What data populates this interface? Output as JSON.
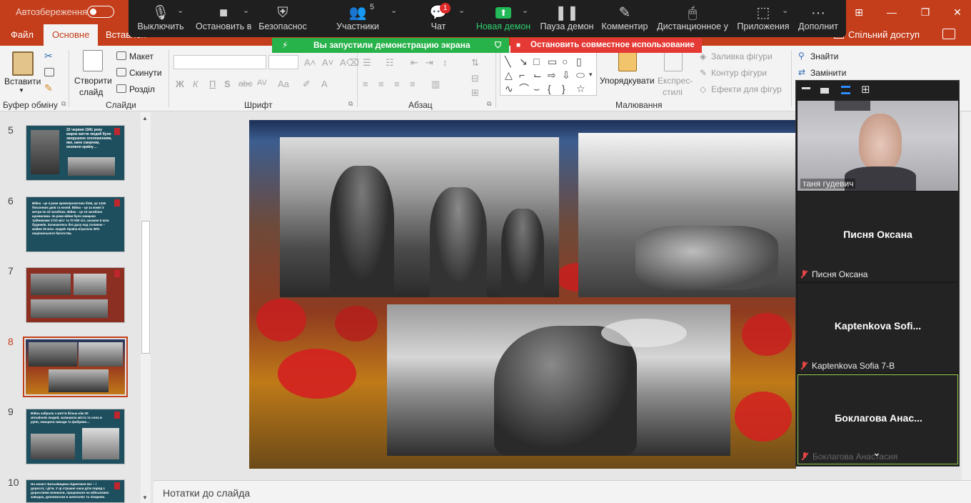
{
  "titlebar": {
    "autosave_label": "Автозбереження",
    "window_controls": [
      "⊞",
      "—",
      "❐",
      "✕"
    ]
  },
  "ribbon_tabs": {
    "file": "Файл",
    "home": "Основне",
    "insert": "Вставлен",
    "share": "Спільний доступ"
  },
  "ribbon": {
    "clipboard": {
      "paste": "Вставити",
      "label": "Буфер обміну"
    },
    "slides": {
      "new_slide_line1": "Створити",
      "new_slide_line2": "слайд",
      "layout": "Макет",
      "reset": "Скинути",
      "section": "Розділ",
      "label": "Слайди"
    },
    "font": {
      "label": "Шрифт",
      "bold": "Ж",
      "italic": "К",
      "underline": "П",
      "strike": "abc",
      "spacing": "AV",
      "case": "Aa"
    },
    "paragraph": {
      "label": "Абзац"
    },
    "drawing": {
      "arrange": "Упорядкувати",
      "quick_styles_line1": "Експрес-",
      "quick_styles_line2": "стилі",
      "shape_fill": "Заливка фігури",
      "shape_outline": "Контур фігури",
      "shape_effects": "Ефекти для фігур",
      "label": "Малювання"
    },
    "editing": {
      "find": "Знайти",
      "replace": "Замінити"
    }
  },
  "zoom_toolbar": {
    "mute": "Выключить",
    "stop_video": "Остановить в",
    "security": "Безопаснос",
    "participants": "Участники",
    "participants_count": "5",
    "chat": "Чат",
    "chat_badge": "1",
    "new_share": "Новая демон",
    "pause_share": "Пауза демон",
    "annotate": "Комментир",
    "remote_control": "Дистанционное у",
    "apps": "Приложения",
    "more": "Дополнит"
  },
  "share_banner": {
    "sharing_text": "Вы запустили демонстрацию экрана",
    "stop_text": "Остановить совместное использование"
  },
  "thumbnails": [
    {
      "num": "5",
      "text": "22 червня 1941 року мирне життя людей було зворушене оголошенням, яке, наче смерчем, охопило країну…"
    },
    {
      "num": "6",
      "text": "Війна - це 4 роки кровопролитних боїв, це 1418 безсонних днів та ночей. Війна – це за кожні 3 метри по 22 загиблих. Війна – це 13 загиблих щохвилини. За роки війни було знищено трійниками 1710 міст та 70 000 сіл, сказано 6 млн. будинків. Залишились без даху над головою – майже 25 млн. людей. Країна втратила 30% національного багатства."
    },
    {
      "num": "7",
      "text": ""
    },
    {
      "num": "8",
      "text": ""
    },
    {
      "num": "9",
      "text": "Війна забрала з життя більш ніж 20 мільйонів людей, залишила міста та села в руїні, знищила заводи та фабрики…"
    },
    {
      "num": "10",
      "text": "На захист Батьківщини піднялися всі – і дорослі, і діти. У ці страшні часи діти поряд з дорослими воювали, працювали на військових заводах, допомагали в шпиталях та лікарнях."
    }
  ],
  "notes_placeholder": "Нотатки до слайда",
  "video_panel": {
    "tiles": [
      {
        "name_label": "таня гудевич",
        "center_name": ""
      },
      {
        "name_label": "Писня Оксана",
        "center_name": "Писня Оксана"
      },
      {
        "name_label": "Kaptenkova Sofia 7-B",
        "center_name": "Kaptenkova  Sofi..."
      },
      {
        "name_label": "Боклагова Анастасия",
        "center_name": "Боклагова  Анас..."
      }
    ]
  },
  "colors": {
    "accent": "#c43e1c",
    "zoom_green": "#28b24a",
    "zoom_red": "#e53935"
  }
}
